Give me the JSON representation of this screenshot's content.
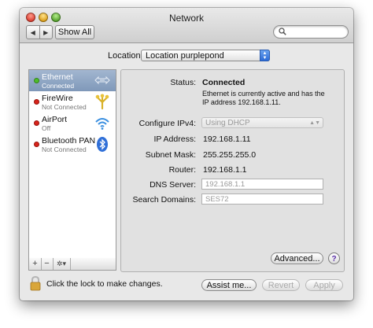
{
  "window": {
    "title": "Network"
  },
  "toolbar": {
    "back_glyph": "◀",
    "forward_glyph": "▶",
    "show_all_label": "Show All",
    "search_placeholder": ""
  },
  "location": {
    "label": "Location:",
    "value": "Location purplepond"
  },
  "services": [
    {
      "name": "Ethernet",
      "status": "Connected",
      "dot_color": "#4ebd2b",
      "icon": "ethernet-icon",
      "selected": true
    },
    {
      "name": "FireWire",
      "status": "Not Connected",
      "dot_color": "#d8231b",
      "icon": "firewire-icon",
      "selected": false
    },
    {
      "name": "AirPort",
      "status": "Off",
      "dot_color": "#d8231b",
      "icon": "wifi-icon",
      "selected": false
    },
    {
      "name": "Bluetooth PAN",
      "status": "Not Connected",
      "dot_color": "#d8231b",
      "icon": "bluetooth-icon",
      "selected": false
    }
  ],
  "sidebar_controls": {
    "add": "+",
    "remove": "−",
    "action": "✲▾"
  },
  "detail": {
    "status_label": "Status:",
    "status_value": "Connected",
    "status_desc": "Ethernet is currently active and has the IP address 192.168.1.11.",
    "configure_label": "Configure IPv4:",
    "configure_value": "Using DHCP",
    "ip_label": "IP Address:",
    "ip_value": "192.168.1.11",
    "subnet_label": "Subnet Mask:",
    "subnet_value": "255.255.255.0",
    "router_label": "Router:",
    "router_value": "192.168.1.1",
    "dns_label": "DNS Server:",
    "dns_value": "192.168.1.1",
    "search_domains_label": "Search Domains:",
    "search_domains_value": "SES72",
    "advanced_label": "Advanced...",
    "help_label": "?"
  },
  "footer": {
    "lock_text": "Click the lock to make changes.",
    "assist_label": "Assist me...",
    "revert_label": "Revert",
    "apply_label": "Apply"
  },
  "colors": {
    "selection": "#8aa2c2",
    "accent_blue": "#2c6bd6",
    "connected": "#4ebd2b",
    "disconnected": "#d8231b"
  }
}
